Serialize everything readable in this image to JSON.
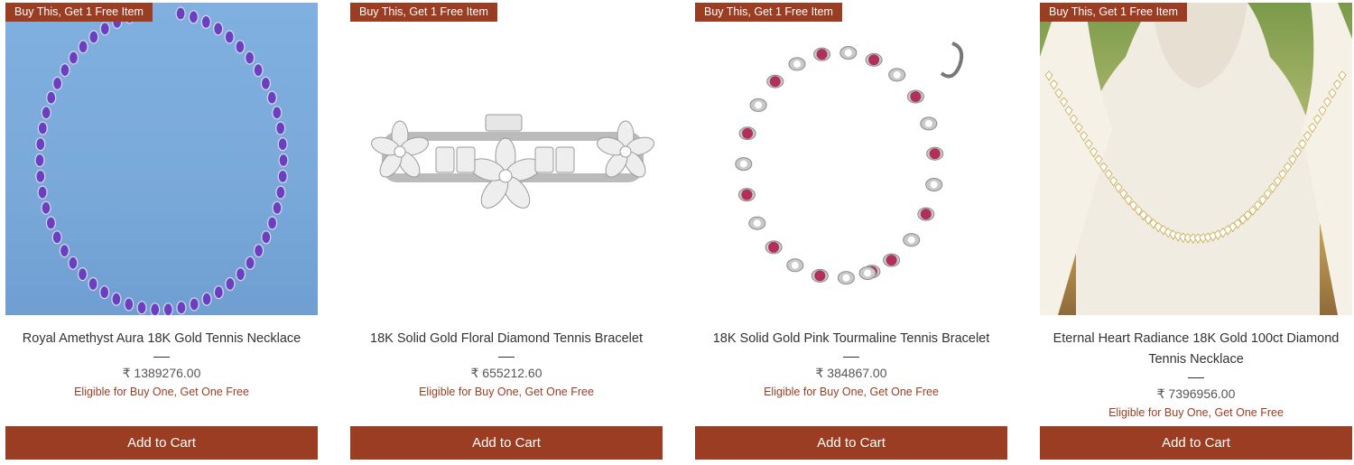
{
  "products": [
    {
      "badge": "Buy This, Get 1 Free Item",
      "image": "amethyst-tennis-necklace",
      "title": "Royal Amethyst Aura 18K Gold Tennis Necklace",
      "price": "₹ 1389276.00",
      "offer": "Eligible for Buy One, Get One Free",
      "cart_label": "Add to Cart"
    },
    {
      "badge": "Buy This, Get 1 Free Item",
      "image": "floral-diamond-bracelet",
      "title": "18K Solid Gold Floral Diamond Tennis Bracelet",
      "price": "₹ 655212.60",
      "offer": "Eligible for Buy One, Get One Free",
      "cart_label": "Add to Cart"
    },
    {
      "badge": "Buy This, Get 1 Free Item",
      "image": "pink-tourmaline-bracelet",
      "title": "18K Solid Gold Pink Tourmaline Tennis Bracelet",
      "price": "₹ 384867.00",
      "offer": "Eligible for Buy One, Get One Free",
      "cart_label": "Add to Cart"
    },
    {
      "badge": "Buy This, Get 1 Free Item",
      "image": "diamond-tennis-necklace-on-bust",
      "title": "Eternal Heart Radiance 18K Gold 100ct Diamond Tennis Necklace",
      "price": "₹ 7396956.00",
      "offer": "Eligible for Buy One, Get One Free",
      "cart_label": "Add to Cart"
    }
  ],
  "colors": {
    "accent": "#9b3d22",
    "text": "#333333",
    "amethyst": "#6a3fc1",
    "tourmaline": "#b0305a"
  }
}
